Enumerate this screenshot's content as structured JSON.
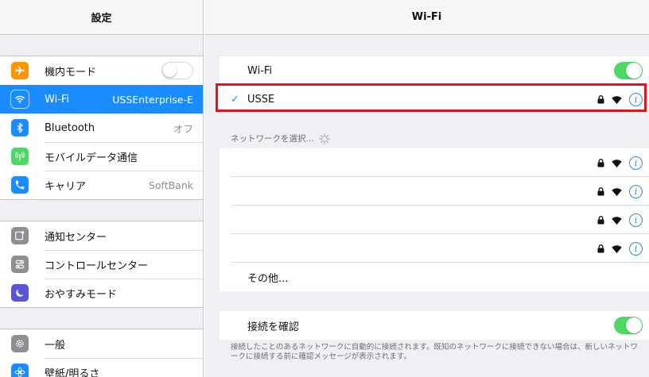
{
  "left_panel": {
    "title": "設定",
    "group1": [
      {
        "name": "airplane",
        "label": "機内モード",
        "value": "",
        "icon": "airplane-icon",
        "color": "#ff9500"
      },
      {
        "name": "wifi",
        "label": "Wi-Fi",
        "value": "USSEnterprise-E",
        "icon": "wifi-icon",
        "color": "#1a8cff",
        "selected": true
      },
      {
        "name": "bluetooth",
        "label": "Bluetooth",
        "value": "オフ",
        "icon": "bluetooth-icon",
        "color": "#1a8cff"
      },
      {
        "name": "cellular",
        "label": "モバイルデータ通信",
        "value": "",
        "icon": "cellular-icon",
        "color": "#4cd964"
      },
      {
        "name": "carrier",
        "label": "キャリア",
        "value": "SoftBank",
        "icon": "phone-icon",
        "color": "#1a8cff"
      }
    ],
    "group2": [
      {
        "name": "notification",
        "label": "通知センター",
        "icon": "notification-icon",
        "color": "#8e8e93"
      },
      {
        "name": "control-center",
        "label": "コントロールセンター",
        "icon": "control-center-icon",
        "color": "#8e8e93"
      },
      {
        "name": "do-not-disturb",
        "label": "おやすみモード",
        "icon": "moon-icon",
        "color": "#5856d6"
      }
    ],
    "group3": [
      {
        "name": "general",
        "label": "一般",
        "icon": "gear-icon",
        "color": "#8e8e93"
      },
      {
        "name": "wallpaper",
        "label": "壁紙/明るさ",
        "icon": "wallpaper-icon",
        "color": "#1a8cff"
      }
    ]
  },
  "right_panel": {
    "title": "Wi-Fi",
    "wifi_label": "Wi-Fi",
    "wifi_on": true,
    "connected_network": "USSE",
    "choose_network_header": "ネットワークを選択...",
    "other_label": "その他...",
    "ask_to_join_label": "接続を確認",
    "ask_to_join_on": true,
    "footer": "接続したことのあるネットワークに自動的に接続されます。既知のネットワークに接続できない場合は、新しいネットワークに接続する前に確認メッセージが表示されます。",
    "info_glyph": "i",
    "check_glyph": "✓"
  },
  "colors": {
    "accent": "#1a8cff",
    "toggle_on": "#4cd964",
    "highlight_frame": "#e8101a"
  }
}
